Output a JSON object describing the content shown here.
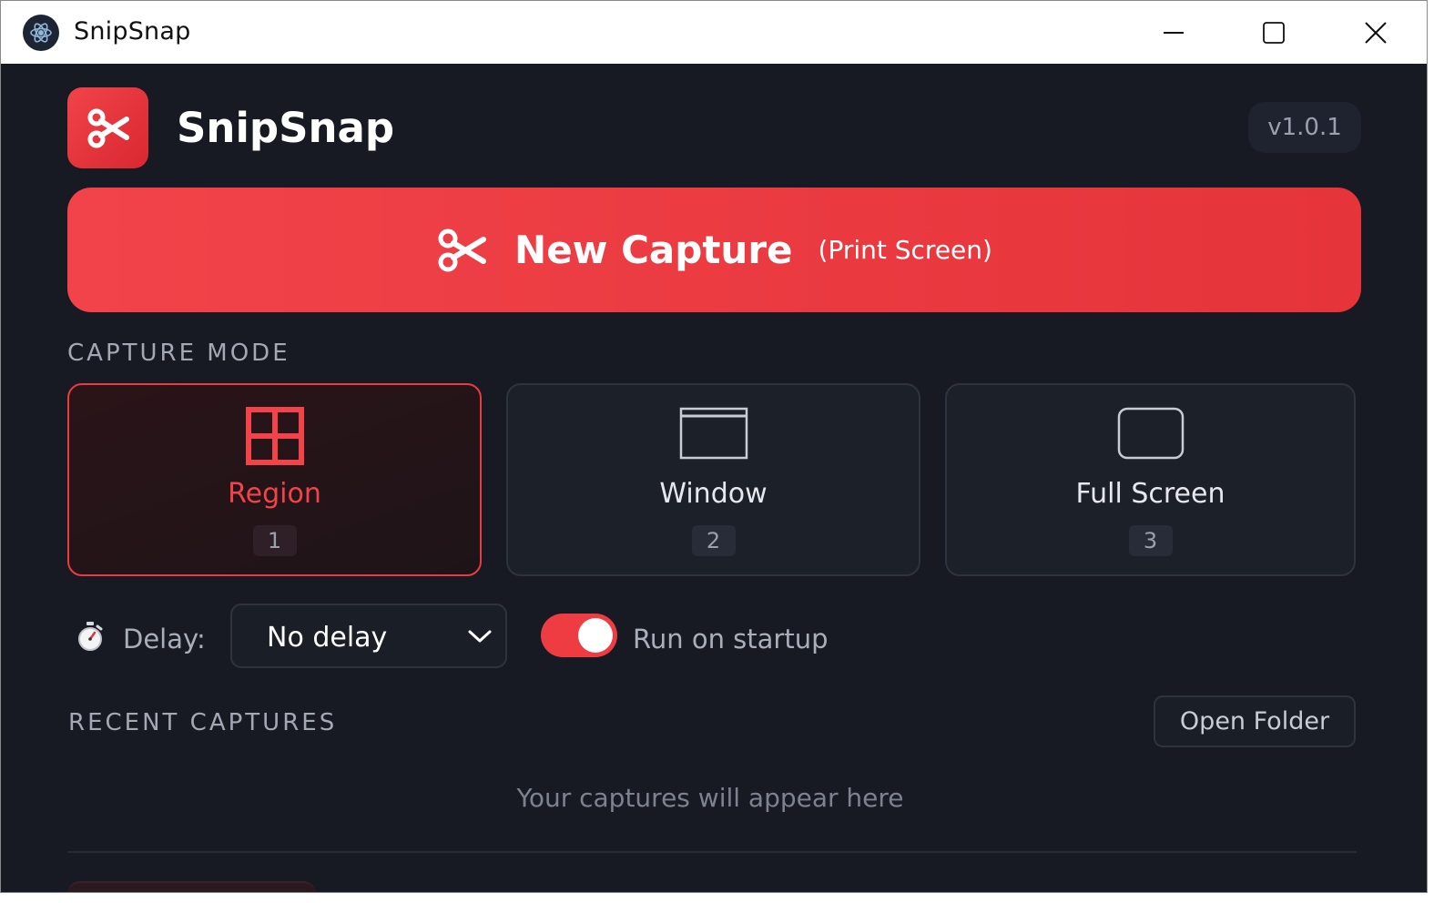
{
  "titlebar": {
    "title": "SnipSnap",
    "icons": [
      "app-logo-icon",
      "minimize-icon",
      "maximize-icon",
      "close-icon"
    ]
  },
  "header": {
    "app_name": "SnipSnap",
    "version": "v1.0.1",
    "logo_icon": "scissors-icon"
  },
  "capture_button": {
    "label": "New Capture",
    "shortcut": "(Print Screen)",
    "icon": "scissors-icon"
  },
  "capture_mode": {
    "section_label": "CAPTURE MODE",
    "modes": [
      {
        "label": "Region",
        "key": "1",
        "icon": "region-grid-icon",
        "active": true
      },
      {
        "label": "Window",
        "key": "2",
        "icon": "window-icon",
        "active": false
      },
      {
        "label": "Full Screen",
        "key": "3",
        "icon": "full-screen-icon",
        "active": false
      }
    ]
  },
  "options": {
    "delay_label": "Delay:",
    "delay_value": "No delay",
    "delay_icon": "stopwatch-icon",
    "run_on_startup_label": "Run on startup",
    "run_on_startup": true
  },
  "recent": {
    "section_label": "RECENT CAPTURES",
    "open_folder_label": "Open Folder",
    "empty_text": "Your captures will appear here"
  },
  "colors": {
    "accent": "#ef3b42",
    "background": "#171a23",
    "card": "#1c2029",
    "border": "#2e3340"
  }
}
